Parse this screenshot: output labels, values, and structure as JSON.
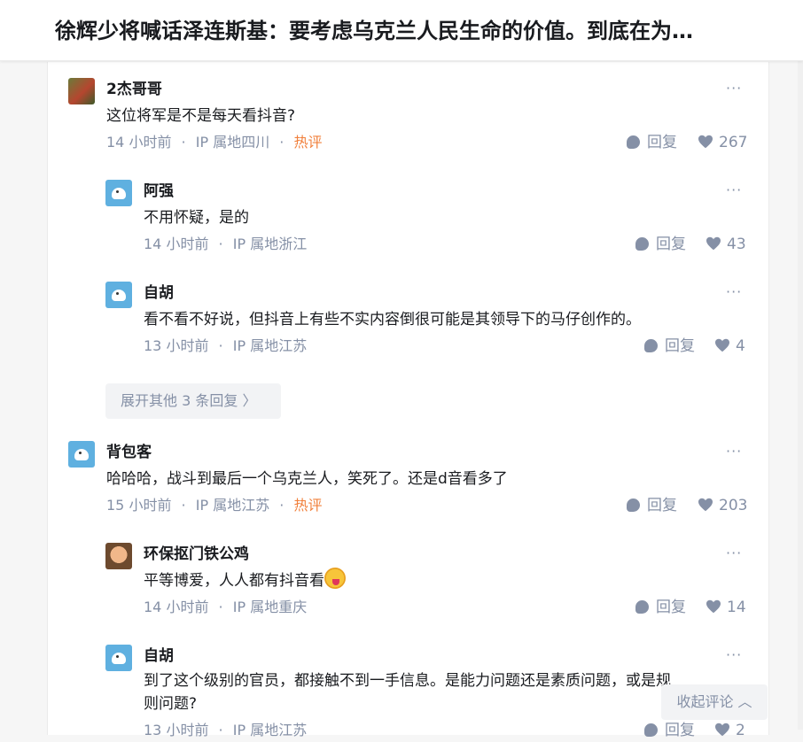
{
  "article": {
    "title": "徐辉少将喊话泽连斯基：要考虑乌克兰人民生命的价值。到底在为…"
  },
  "comments": [
    {
      "name": "2杰哥哥",
      "text": "这位将军是不是每天看抖音?",
      "time": "14 小时前",
      "ip": "IP 属地四川",
      "hot": "热评",
      "reply": "回复",
      "likes": "267"
    },
    {
      "name": "阿强",
      "text": "不用怀疑，是的",
      "time": "14 小时前",
      "ip": "IP 属地浙江",
      "reply": "回复",
      "likes": "43"
    },
    {
      "name": "自胡",
      "text": "看不看不好说，但抖音上有些不实内容倒很可能是其领导下的马仔创作的。",
      "time": "13 小时前",
      "ip": "IP 属地江苏",
      "reply": "回复",
      "likes": "4"
    },
    {
      "name": "背包客",
      "text": "哈哈哈，战斗到最后一个乌克兰人，笑死了。还是d音看多了",
      "time": "15 小时前",
      "ip": "IP 属地江苏",
      "hot": "热评",
      "reply": "回复",
      "likes": "203"
    },
    {
      "name": "环保抠门铁公鸡",
      "text": "平等博爱，人人都有抖音看",
      "time": "14 小时前",
      "ip": "IP 属地重庆",
      "reply": "回复",
      "likes": "14"
    },
    {
      "name": "自胡",
      "text": "到了这个级别的官员，都接触不到一手信息。是能力问题还是素质问题，或是规则问题?",
      "time": "13 小时前",
      "ip": "IP 属地江苏",
      "reply": "回复",
      "likes": "2"
    }
  ],
  "meta_separator": "·",
  "more_label": "···",
  "expand_replies": "展开其他 3 条回复 〉",
  "collapse_comments": "收起评论 ︿",
  "colors": {
    "meta": "#8590a6",
    "hot": "#f1803c",
    "expand_bg": "#f2f3f5"
  },
  "icons": {
    "reply": "comment-bubble-icon",
    "like": "heart-icon"
  }
}
